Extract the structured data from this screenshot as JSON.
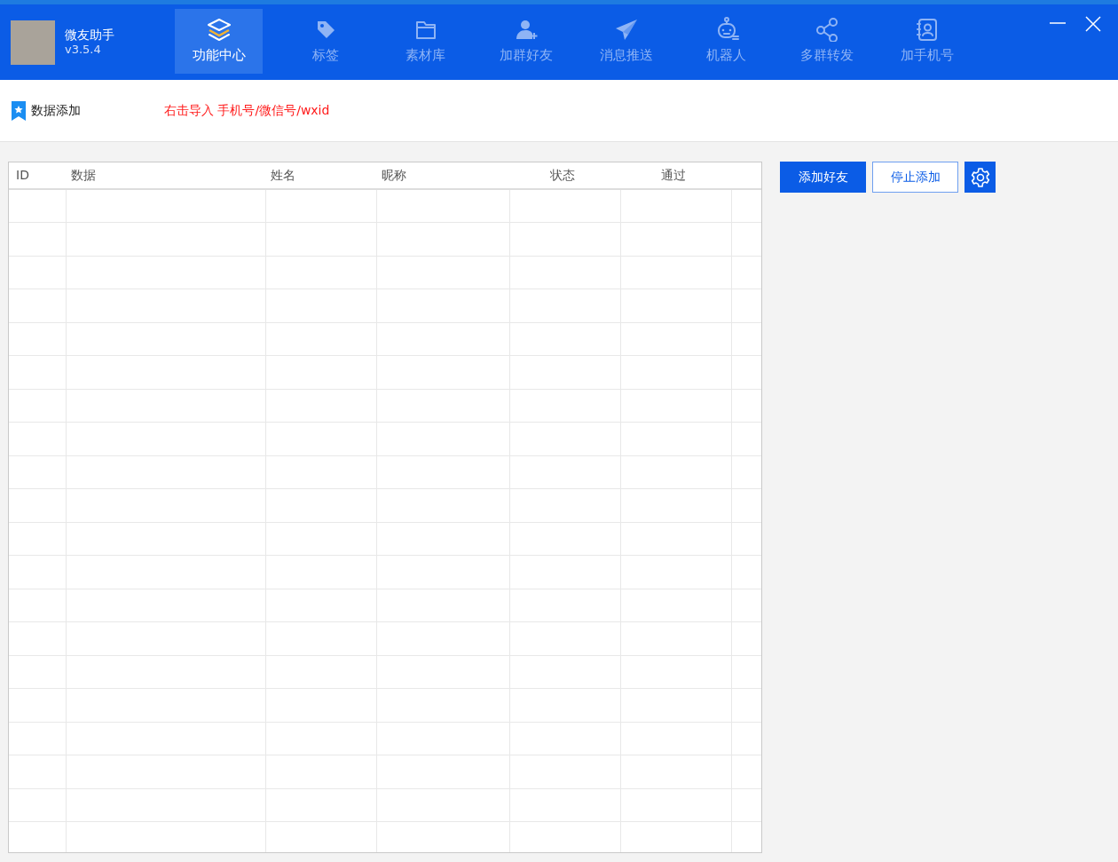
{
  "app": {
    "name": "微友助手",
    "version": "v3.5.4"
  },
  "nav_tabs": [
    {
      "label": "功能中心",
      "selected": true
    },
    {
      "label": "标签",
      "selected": false
    },
    {
      "label": "素材库",
      "selected": false
    },
    {
      "label": "加群好友",
      "selected": false
    },
    {
      "label": "消息推送",
      "selected": false
    },
    {
      "label": "机器人",
      "selected": false
    },
    {
      "label": "多群转发",
      "selected": false
    },
    {
      "label": "加手机号",
      "selected": false
    }
  ],
  "section": {
    "title": "数据添加",
    "hint": "右击导入 手机号/微信号/wxid"
  },
  "table": {
    "columns": [
      "ID",
      "数据",
      "姓名",
      "昵称",
      "状态",
      "通过"
    ]
  },
  "actions": [
    {
      "kind": "primary",
      "label": "添加好友"
    },
    {
      "kind": "outline",
      "label": "停止添加"
    },
    {
      "kind": "settings"
    }
  ]
}
